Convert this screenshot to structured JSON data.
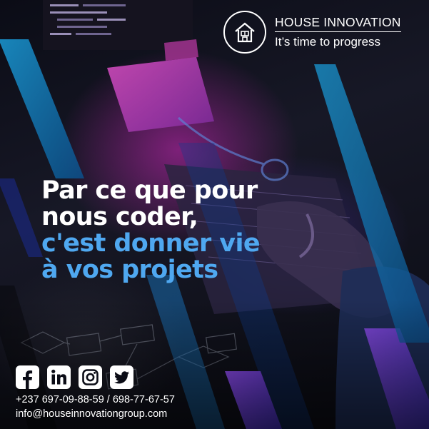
{
  "brand": {
    "name": "HOUSE INNOVATION",
    "tagline": "It’s time to progress"
  },
  "headline": {
    "line1": "Par ce que pour",
    "line2": "nous coder,",
    "line3": "c'est donner vie",
    "line4": "à vos projets"
  },
  "socials": [
    {
      "icon": "facebook-icon"
    },
    {
      "icon": "linkedin-icon"
    },
    {
      "icon": "instagram-icon"
    },
    {
      "icon": "twitter-icon"
    }
  ],
  "contact": {
    "phone": "+237 697-09-88-59 / 698-77-67-57",
    "email": "info@houseinnovationgroup.com"
  },
  "colors": {
    "accent_blue": "#4fa8f0",
    "brand_blue": "#1d8fc7",
    "brand_purple": "#6f3bd6",
    "text": "#ffffff"
  }
}
